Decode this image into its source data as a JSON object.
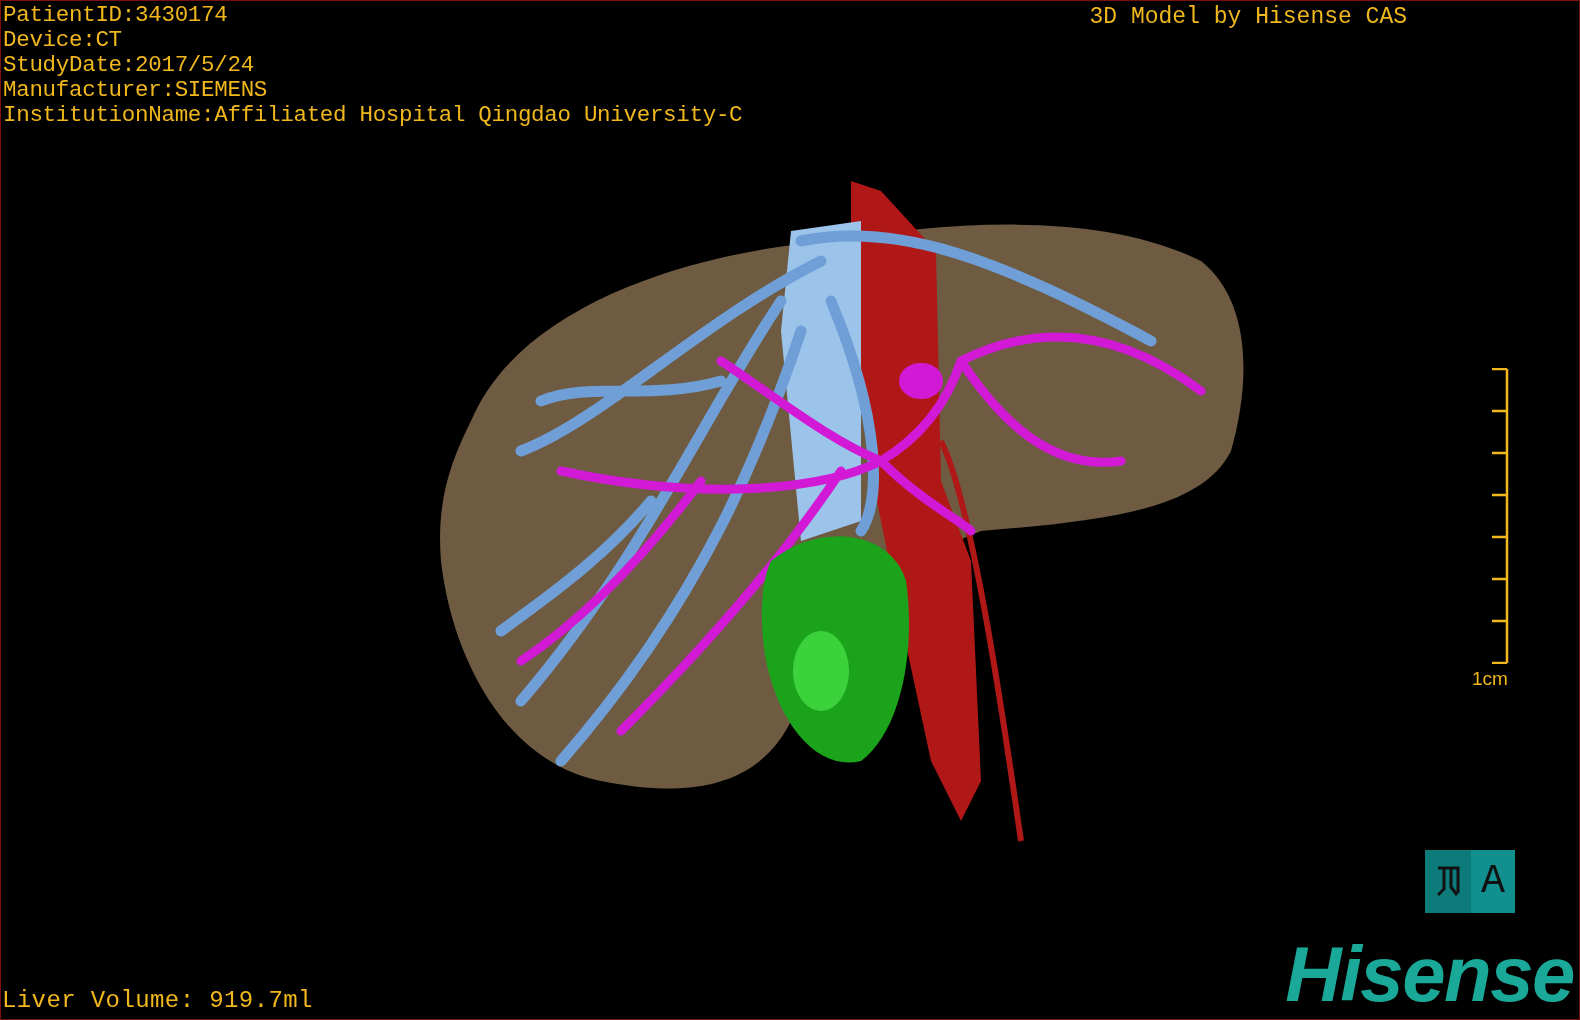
{
  "viewport": {
    "patient_info": [
      "PatientID:3430174",
      "Device:CT",
      "StudyDate:2017/5/24",
      "Manufacturer:SIEMENS",
      "InstitutionName:Affiliated Hospital Qingdao University-C"
    ],
    "title": "3D Model by Hisense CAS",
    "scale_bar": {
      "label": "1cm"
    },
    "orientation_cube": {
      "face": "A"
    },
    "measurement": "Liver Volume: 919.7ml",
    "logo": "Hisense"
  }
}
